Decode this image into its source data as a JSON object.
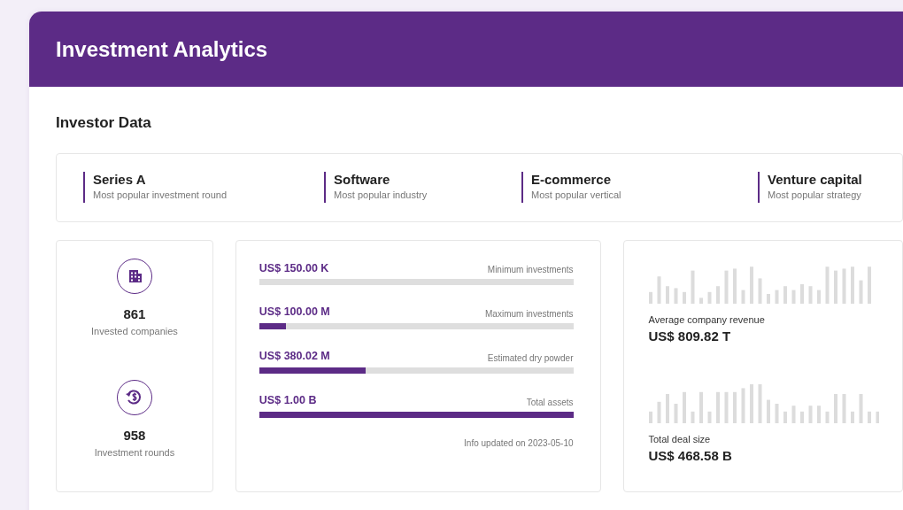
{
  "header": {
    "title": "Investment Analytics"
  },
  "section_title": "Investor Data",
  "highlights": [
    {
      "value": "Series A",
      "label": "Most popular investment round"
    },
    {
      "value": "Software",
      "label": "Most popular industry"
    },
    {
      "value": "E-commerce",
      "label": "Most popular vertical"
    },
    {
      "value": "Venture capital",
      "label": "Most popular strategy"
    }
  ],
  "counts": [
    {
      "kind": "building",
      "value": "861",
      "label": "Invested companies"
    },
    {
      "kind": "money",
      "value": "958",
      "label": "Investment rounds"
    }
  ],
  "amounts": [
    {
      "value": "US$ 150.00 K",
      "label": "Minimum investments",
      "level": 0
    },
    {
      "value": "US$ 100.00 M",
      "label": "Maximum investments",
      "level": 0.085
    },
    {
      "value": "US$ 380.02 M",
      "label": "Estimated dry powder",
      "level": 0.34
    },
    {
      "value": "US$ 1.00 B",
      "label": "Total assets",
      "level": 1
    }
  ],
  "info_updated": "Info updated  on 2023-05-10",
  "metrics": [
    {
      "label": "Average company revenue",
      "value": "US$ 809.82 T"
    },
    {
      "label": "Total deal size",
      "value": "US$ 468.58 B"
    }
  ]
}
